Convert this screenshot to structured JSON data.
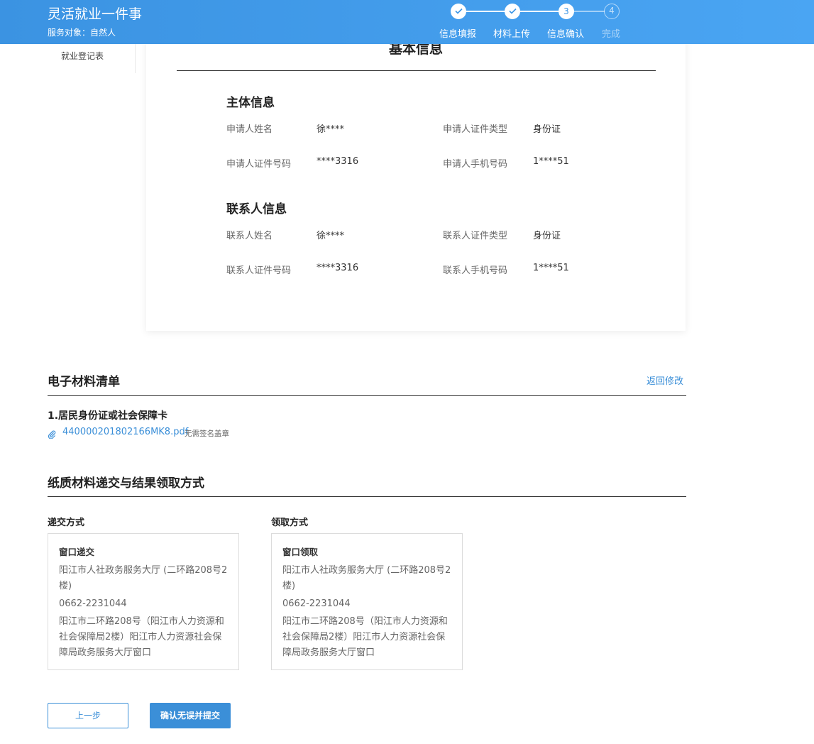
{
  "header": {
    "title": "灵活就业一件事",
    "service_target": "服务对象：自然人",
    "steps": [
      {
        "number": "1",
        "label": "信息填报",
        "status": "done"
      },
      {
        "number": "2",
        "label": "材料上传",
        "status": "done"
      },
      {
        "number": "3",
        "label": "信息确认",
        "status": "active"
      },
      {
        "number": "4",
        "label": "完成",
        "status": "pending"
      }
    ]
  },
  "sidebar": {
    "items": [
      {
        "label": "就业登记表"
      }
    ]
  },
  "basic_info": {
    "title": "基本信息",
    "subject": {
      "title": "主体信息",
      "fields": [
        {
          "label": "申请人姓名",
          "value": "徐****"
        },
        {
          "label": "申请人证件类型",
          "value": "身份证"
        },
        {
          "label": "申请人证件号码",
          "value": "****3316"
        },
        {
          "label": "申请人手机号码",
          "value": "1****51"
        }
      ]
    },
    "contact": {
      "title": "联系人信息",
      "fields": [
        {
          "label": "联系人姓名",
          "value": "徐****"
        },
        {
          "label": "联系人证件类型",
          "value": "身份证"
        },
        {
          "label": "联系人证件号码",
          "value": "****3316"
        },
        {
          "label": "联系人手机号码",
          "value": "1****51"
        }
      ]
    }
  },
  "materials": {
    "title": "电子材料清单",
    "back_link": "返回修改",
    "items": [
      {
        "title": "1.居民身份证或社会保障卡",
        "file": "440000201802166MK8.pdf",
        "note": "无需签名盖章"
      }
    ]
  },
  "paper": {
    "title": "纸质材料递交与结果领取方式",
    "submit": {
      "label": "递交方式",
      "name": "窗口递交",
      "lines": [
        "阳江市人社政务服务大厅 (二环路208号2楼)",
        "0662-2231044",
        "阳江市二环路208号（阳江市人力资源和社会保障局2楼）阳江市人力资源社会保障局政务服务大厅窗口"
      ]
    },
    "pickup": {
      "label": "领取方式",
      "name": "窗口领取",
      "lines": [
        "阳江市人社政务服务大厅 (二环路208号2楼)",
        "0662-2231044",
        "阳江市二环路208号（阳江市人力资源和社会保障局2楼）阳江市人力资源社会保障局政务服务大厅窗口"
      ]
    }
  },
  "actions": {
    "prev": "上一步",
    "submit": "确认无误并提交"
  },
  "icons": {
    "clip": "paperclip-icon",
    "check": "check-icon"
  },
  "colors": {
    "header": "#3b93e2",
    "accent": "#3b8fd8"
  }
}
